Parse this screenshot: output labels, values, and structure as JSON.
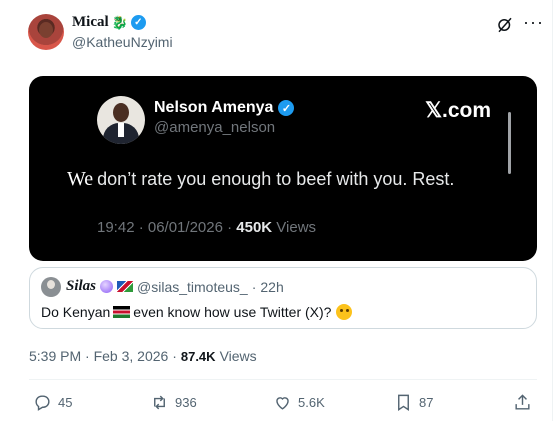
{
  "author": {
    "name": "Mical",
    "name_emoji": "🐉",
    "handle": "@KatheuNzyimi"
  },
  "embedded_screenshot": {
    "name": "Nelson Amenya",
    "handle": "@amenya_nelson",
    "brand": "𝕏.com",
    "text_first_word": "We",
    "text_rest": "don’t rate you enough to beef with you. Rest.",
    "meta_time": "19:42 · 06/01/2026 · ",
    "meta_views_count": "450K",
    "meta_views_label": " Views"
  },
  "quote": {
    "name": "Silas",
    "handle": "@silas_timoteus_",
    "sep": "·",
    "age": "22h",
    "body_before": "Do Kenyan",
    "body_after": " even know how use Twitter (X)?"
  },
  "timestamp": {
    "time": "5:39 PM · Feb 3, 2026 ·",
    "views_count": "87.4K",
    "views_label": "Views"
  },
  "actions": {
    "replies": "45",
    "reposts": "936",
    "likes": "5.6K",
    "bookmarks": "87"
  },
  "colors": {
    "accent": "#1d9bf0",
    "text": "#0f1419",
    "muted": "#536471",
    "embed_bg": "#000000"
  }
}
